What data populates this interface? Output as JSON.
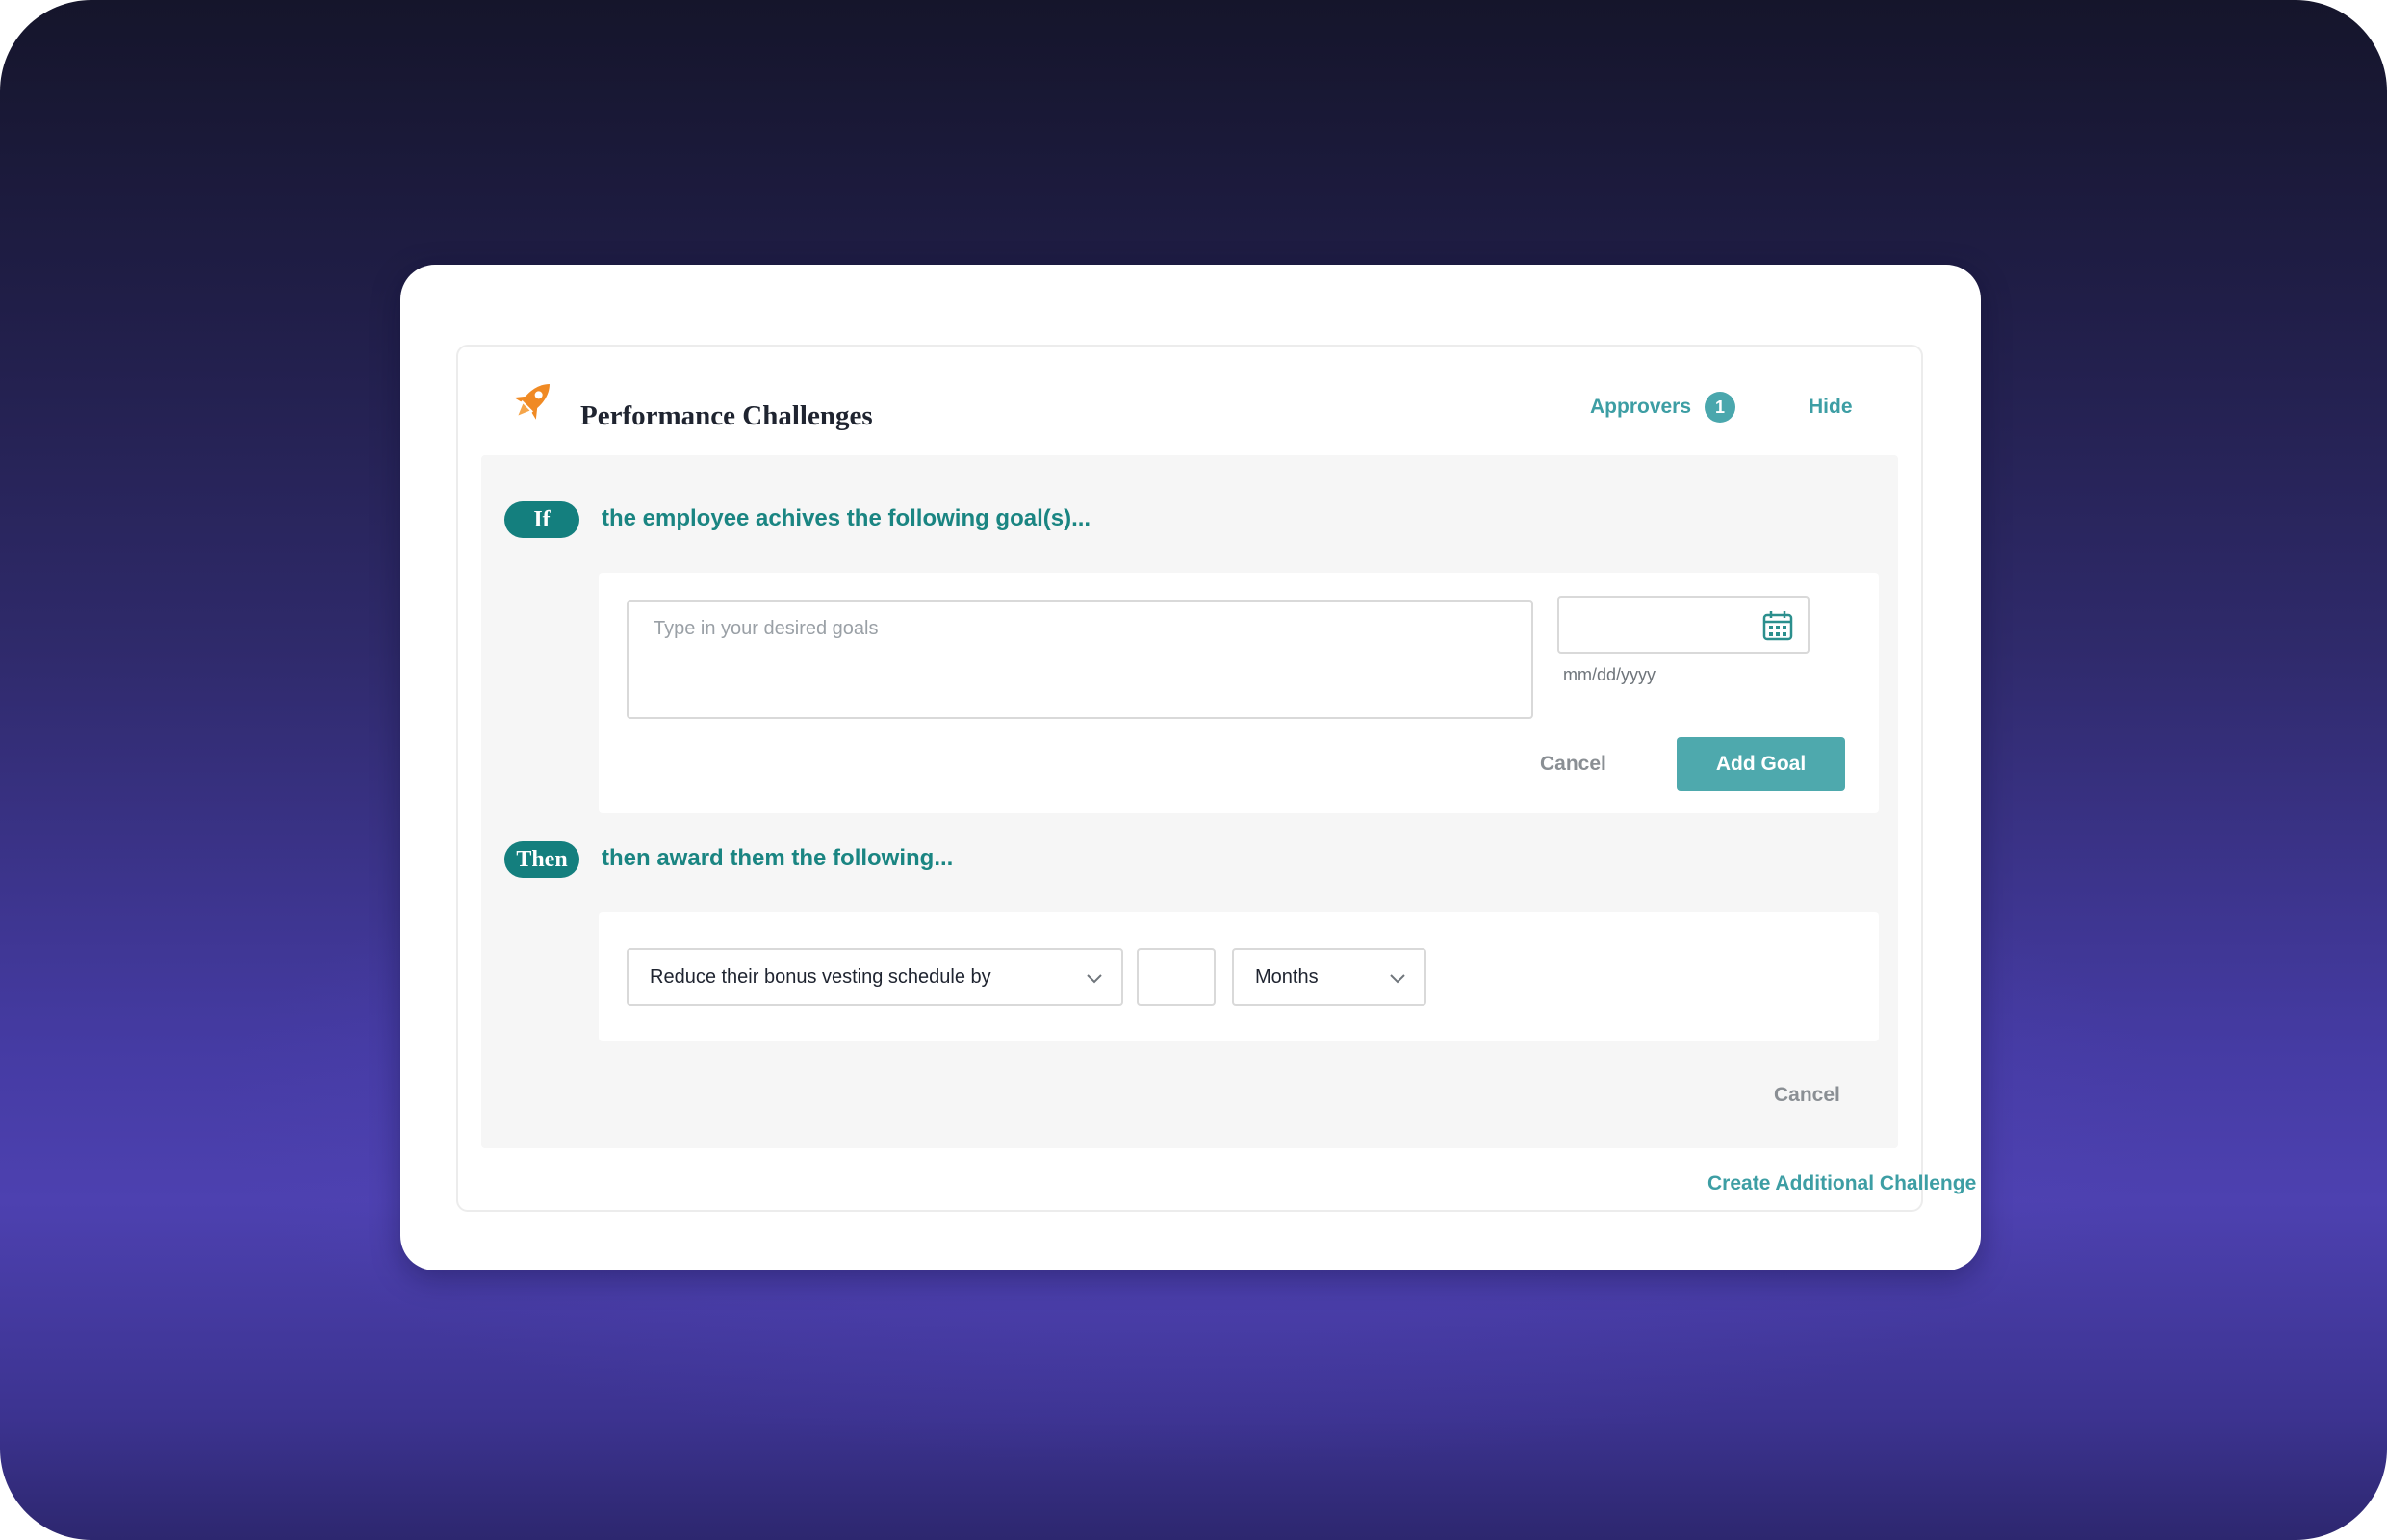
{
  "header": {
    "title": "Performance Challenges",
    "approvers_label": "Approvers",
    "approvers_count": "1",
    "hide_label": "Hide"
  },
  "if_section": {
    "pill": "If",
    "text": "the employee achives the following goal(s)...",
    "goal_placeholder": "Type in your desired goals",
    "date_placeholder": "mm/dd/yyyy",
    "cancel_label": "Cancel",
    "add_goal_label": "Add Goal"
  },
  "then_section": {
    "pill": "Then",
    "text": "then award them the following...",
    "action_value": "Reduce their bonus vesting schedule by",
    "units_value": "Months",
    "cancel_label": "Cancel"
  },
  "footer": {
    "create_label": "Create Additional Challenge"
  },
  "colors": {
    "accent": "#147f7e",
    "link": "#3d9ea4",
    "button": "#4ea9ad",
    "rocket": "#f08a24"
  },
  "icons": [
    "rocket-icon",
    "calendar-icon",
    "chevron-down-icon"
  ]
}
